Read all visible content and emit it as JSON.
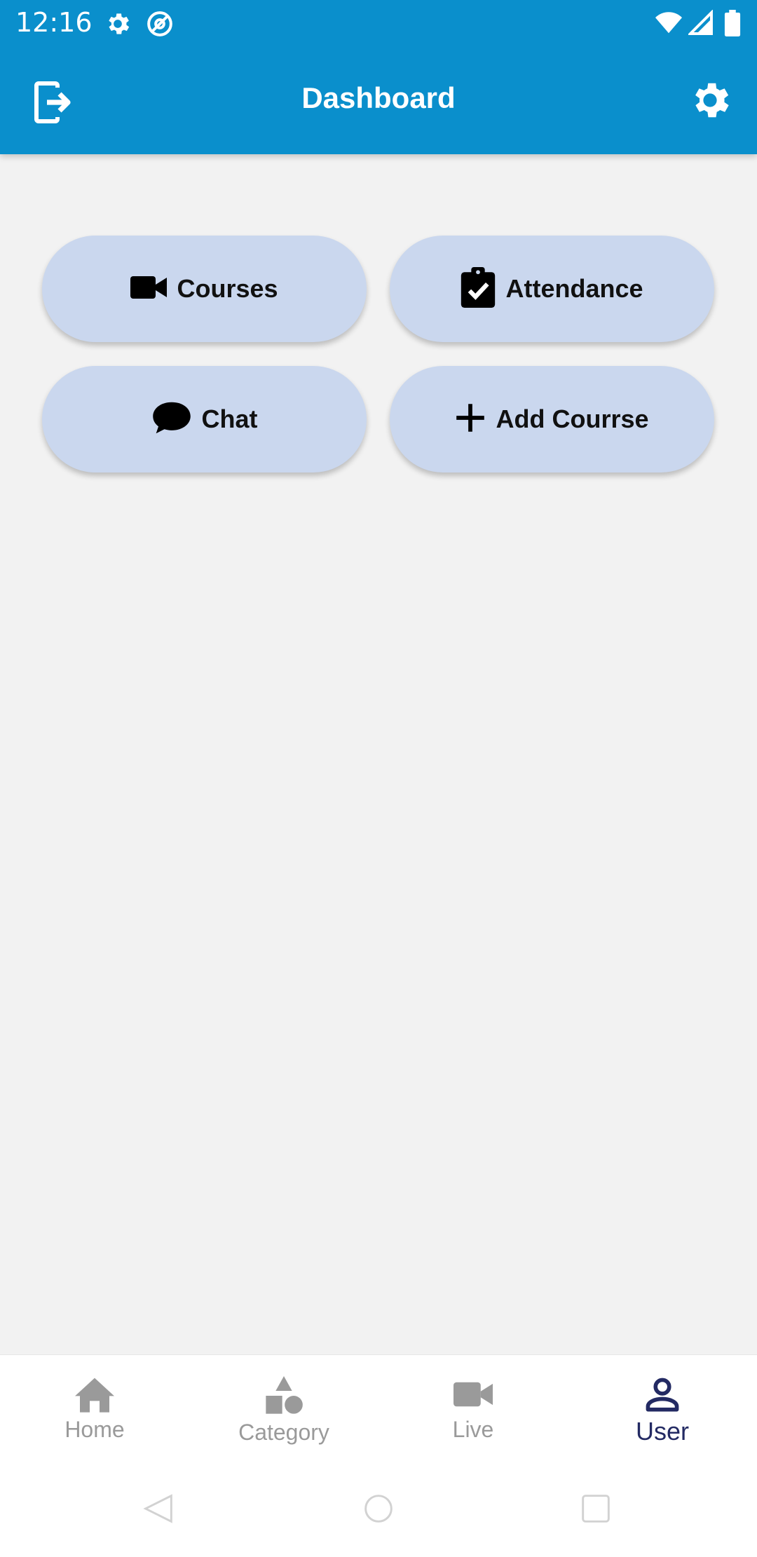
{
  "status_bar": {
    "time": "12:16",
    "left_icons": [
      "settings-gear-icon",
      "at-sign-icon"
    ],
    "right_icons": [
      "wifi-icon",
      "cell-signal-icon",
      "battery-icon"
    ]
  },
  "app_bar": {
    "title": "Dashboard",
    "left_icon": "logout-icon",
    "right_icon": "settings-icon",
    "background": "#0a8fcc"
  },
  "dashboard": {
    "tiles": [
      {
        "label": "Courses",
        "icon": "video-camera-icon"
      },
      {
        "label": "Attendance",
        "icon": "clipboard-check-icon"
      },
      {
        "label": "Chat",
        "icon": "chat-bubble-icon"
      },
      {
        "label": "Add Courrse",
        "icon": "plus-icon"
      }
    ],
    "tile_color": "#cad7ee"
  },
  "bottom_nav": {
    "items": [
      {
        "label": "Home",
        "icon": "home-icon",
        "active": false
      },
      {
        "label": "Category",
        "icon": "shapes-icon",
        "active": false
      },
      {
        "label": "Live",
        "icon": "video-camera-icon",
        "active": false
      },
      {
        "label": "User",
        "icon": "user-icon",
        "active": true
      }
    ],
    "active_color": "#232a63",
    "inactive_color": "#9a9a9a"
  },
  "system_nav": [
    "back-icon",
    "home-circle-icon",
    "recents-icon"
  ]
}
